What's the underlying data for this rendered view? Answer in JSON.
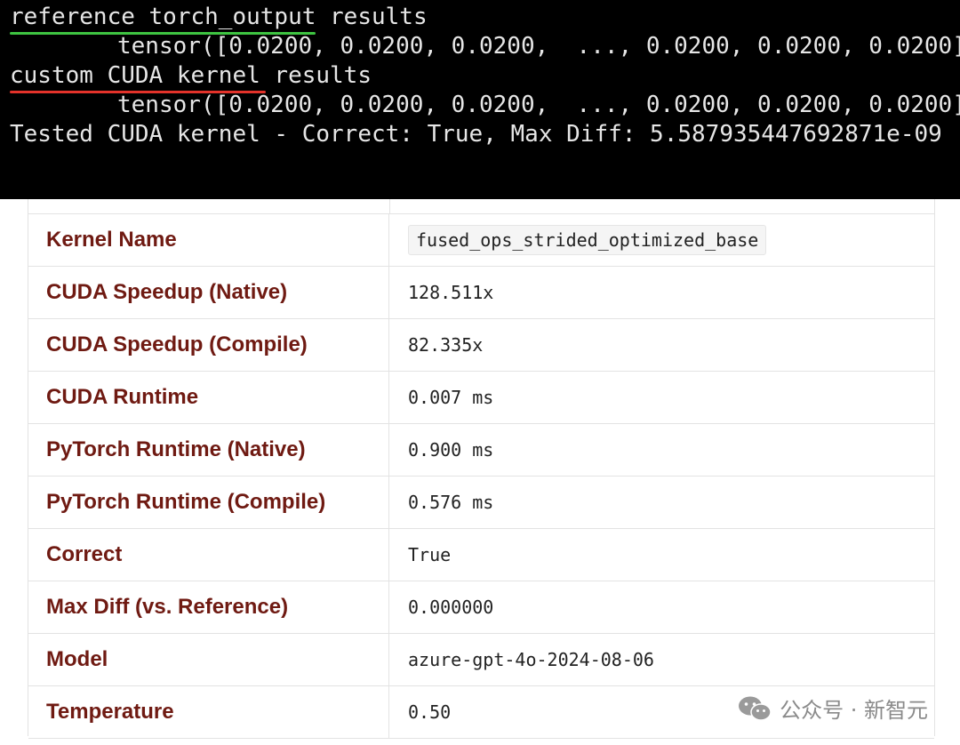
{
  "terminal": {
    "line1_label": "reference torch_output",
    "line1_suffix": " results",
    "line2": "tensor([0.0200, 0.0200, 0.0200,  ..., 0.0200, 0.0200, 0.0200])",
    "line3_label": "custom CUDA kernel",
    "line3_suffix": " results",
    "line4": "tensor([0.0200, 0.0200, 0.0200,  ..., 0.0200, 0.0200, 0.0200])",
    "line5": "Tested CUDA kernel - Correct: True, Max Diff: 5.587935447692871e-09",
    "underline_colors": {
      "reference": "#3ec441",
      "custom": "#e3322a"
    }
  },
  "table": {
    "rows": [
      {
        "key": "Kernel Name",
        "value": "fused_ops_strided_optimized_base"
      },
      {
        "key": "CUDA Speedup (Native)",
        "value": "128.511x"
      },
      {
        "key": "CUDA Speedup (Compile)",
        "value": "82.335x"
      },
      {
        "key": "CUDA Runtime",
        "value": "0.007 ms"
      },
      {
        "key": "PyTorch Runtime (Native)",
        "value": "0.900 ms"
      },
      {
        "key": "PyTorch Runtime (Compile)",
        "value": "0.576 ms"
      },
      {
        "key": "Correct",
        "value": "True"
      },
      {
        "key": "Max Diff (vs. Reference)",
        "value": "0.000000"
      },
      {
        "key": "Model",
        "value": "azure-gpt-4o-2024-08-06"
      },
      {
        "key": "Temperature",
        "value": "0.50"
      }
    ],
    "key_color": "#6f1a12"
  },
  "watermark": {
    "text": "公众号 · 新智元",
    "icon": "wechat-icon"
  }
}
